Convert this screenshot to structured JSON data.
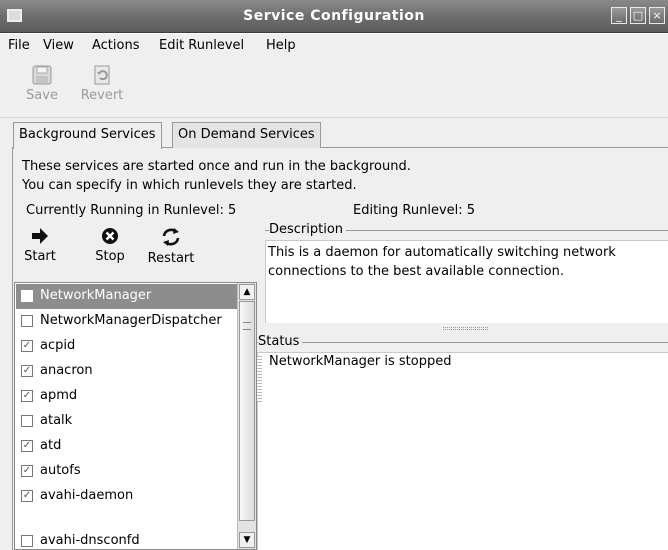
{
  "window": {
    "title": "Service Configuration"
  },
  "menu": {
    "file": "File",
    "view": "View",
    "actions": "Actions",
    "edit_runlevel": "Edit Runlevel",
    "help": "Help"
  },
  "toolbar": {
    "save_label": "Save",
    "revert_label": "Revert"
  },
  "tabs": [
    {
      "label": "Background Services",
      "active": true
    },
    {
      "label": "On Demand Services",
      "active": false
    }
  ],
  "intro": {
    "line1": "These services are started once and run in the background.",
    "line2": "You can specify in which runlevels they are started."
  },
  "runlevel": {
    "current": "Currently Running in Runlevel: 5",
    "editing": "Editing Runlevel: 5"
  },
  "controls": {
    "start": "Start",
    "stop": "Stop",
    "restart": "Restart"
  },
  "services": [
    {
      "name": "NetworkManager",
      "checked": false,
      "selected": true
    },
    {
      "name": "NetworkManagerDispatcher",
      "checked": false,
      "selected": false
    },
    {
      "name": "acpid",
      "checked": true,
      "selected": false
    },
    {
      "name": "anacron",
      "checked": true,
      "selected": false
    },
    {
      "name": "apmd",
      "checked": true,
      "selected": false
    },
    {
      "name": "atalk",
      "checked": false,
      "selected": false
    },
    {
      "name": "atd",
      "checked": true,
      "selected": false
    },
    {
      "name": "autofs",
      "checked": true,
      "selected": false
    },
    {
      "name": "avahi-daemon",
      "checked": true,
      "selected": false
    },
    {
      "name": "avahi-dnsconfd",
      "checked": false,
      "selected": false
    }
  ],
  "description": {
    "label": "Description",
    "text": "This is a daemon for automatically switching network connections to the best available connection."
  },
  "status": {
    "label": "Status",
    "text": "NetworkManager is stopped"
  },
  "colors": {
    "titlebar": "#6e6e6e",
    "selection": "#8d8d8d",
    "background": "#efefef"
  }
}
